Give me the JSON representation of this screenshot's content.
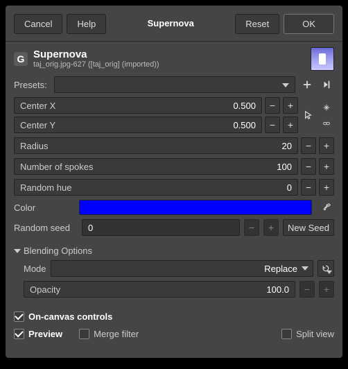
{
  "buttons": {
    "cancel": "Cancel",
    "help": "Help",
    "title": "Supernova",
    "reset": "Reset",
    "ok": "OK"
  },
  "header": {
    "title": "Supernova",
    "subtitle": "taj_orig.jpg-627 ([taj_orig] (imported))"
  },
  "presets": {
    "label": "Presets:"
  },
  "params": {
    "centerX": {
      "label": "Center X",
      "value": "0.500"
    },
    "centerY": {
      "label": "Center Y",
      "value": "0.500"
    },
    "radius": {
      "label": "Radius",
      "value": "20"
    },
    "spokes": {
      "label": "Number of spokes",
      "value": "100"
    },
    "randomHue": {
      "label": "Random hue",
      "value": "0"
    }
  },
  "color": {
    "label": "Color",
    "hex": "#0000ff"
  },
  "seed": {
    "label": "Random seed",
    "value": "0",
    "newseed": "New Seed"
  },
  "blending": {
    "title": "Blending Options",
    "modeLabel": "Mode",
    "modeValue": "Replace",
    "opacityLabel": "Opacity",
    "opacityValue": "100.0"
  },
  "checks": {
    "onCanvas": "On-canvas controls",
    "preview": "Preview",
    "merge": "Merge filter",
    "split": "Split view"
  }
}
